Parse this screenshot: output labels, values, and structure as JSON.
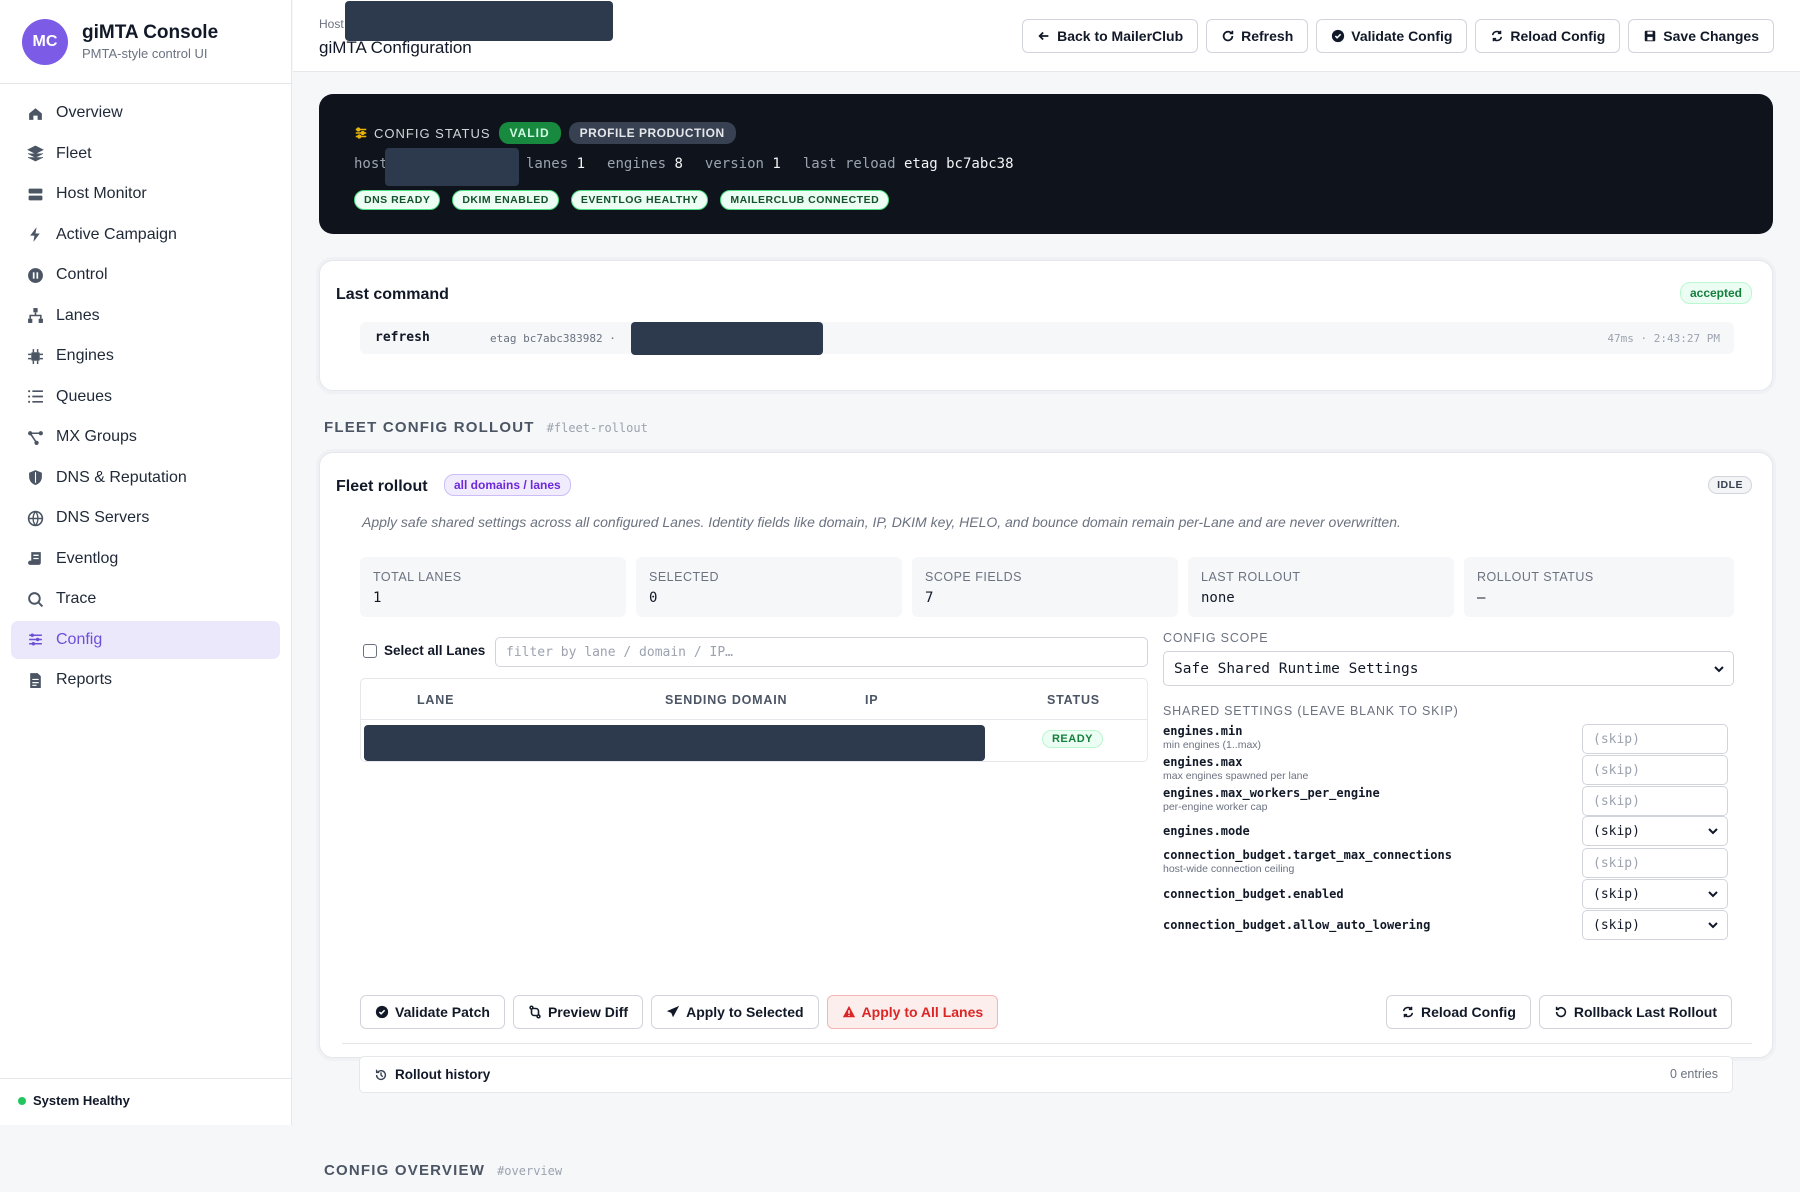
{
  "brand": {
    "initials": "MC",
    "title": "giMTA Console",
    "subtitle": "PMTA-style control UI"
  },
  "nav": [
    {
      "label": "Overview",
      "icon": "home-icon"
    },
    {
      "label": "Fleet",
      "icon": "layers-icon"
    },
    {
      "label": "Host Monitor",
      "icon": "server-icon"
    },
    {
      "label": "Active Campaign",
      "icon": "bolt-icon"
    },
    {
      "label": "Control",
      "icon": "pause-icon"
    },
    {
      "label": "Lanes",
      "icon": "network-icon"
    },
    {
      "label": "Engines",
      "icon": "chip-icon"
    },
    {
      "label": "Queues",
      "icon": "list-icon"
    },
    {
      "label": "MX Groups",
      "icon": "share-icon"
    },
    {
      "label": "DNS & Reputation",
      "icon": "shield-icon"
    },
    {
      "label": "DNS Servers",
      "icon": "globe-icon"
    },
    {
      "label": "Eventlog",
      "icon": "scroll-icon"
    },
    {
      "label": "Trace",
      "icon": "search-icon"
    },
    {
      "label": "Config",
      "icon": "sliders-icon",
      "active": true
    },
    {
      "label": "Reports",
      "icon": "file-icon"
    }
  ],
  "system_status": "System Healthy",
  "header": {
    "crumb": "Host",
    "title": "giMTA Configuration",
    "actions": [
      "Back to MailerClub",
      "Refresh",
      "Validate Config",
      "Reload Config",
      "Save Changes"
    ]
  },
  "config_status": {
    "label": "CONFIG STATUS",
    "valid": "VALID",
    "profile": "PROFILE PRODUCTION",
    "host_key": "host",
    "lanes_key": "lanes",
    "lanes_val": "1",
    "engines_key": "engines",
    "engines_val": "8",
    "version_key": "version",
    "version_val": "1",
    "reload_key": "last reload",
    "reload_val": "etag bc7abc38",
    "tags": [
      "DNS READY",
      "DKIM ENABLED",
      "EVENTLOG HEALTHY",
      "MAILERCLUB CONNECTED"
    ]
  },
  "last_command": {
    "title": "Last command",
    "badge": "accepted",
    "name": "refresh",
    "etag": "etag bc7abc383982 ·",
    "timing": "47ms · 2:43:27 PM"
  },
  "rollout_section": {
    "title": "FLEET CONFIG ROLLOUT",
    "anchor": "#fleet-rollout"
  },
  "rollout": {
    "title": "Fleet rollout",
    "scope_badge": "all domains / lanes",
    "state": "IDLE",
    "description": "Apply safe shared settings across all configured Lanes. Identity fields like domain, IP, DKIM key, HELO, and bounce domain remain per-Lane and are never overwritten.",
    "stats": [
      {
        "label": "TOTAL LANES",
        "value": "1"
      },
      {
        "label": "SELECTED",
        "value": "0"
      },
      {
        "label": "SCOPE FIELDS",
        "value": "7"
      },
      {
        "label": "LAST ROLLOUT",
        "value": "none"
      },
      {
        "label": "ROLLOUT STATUS",
        "value": "–"
      }
    ],
    "select_all": "Select all Lanes",
    "filter_placeholder": "filter by lane / domain / IP…",
    "columns": [
      "LANE",
      "SENDING DOMAIN",
      "IP",
      "STATUS"
    ],
    "row_status": "READY",
    "scope_label": "CONFIG SCOPE",
    "scope_value": "Safe Shared Runtime Settings",
    "shared_label": "SHARED SETTINGS (LEAVE BLANK TO SKIP)",
    "settings": [
      {
        "key": "engines.min",
        "desc": "min engines (1..max)",
        "control": "input",
        "value": "(skip)"
      },
      {
        "key": "engines.max",
        "desc": "max engines spawned per lane",
        "control": "input",
        "value": "(skip)"
      },
      {
        "key": "engines.max_workers_per_engine",
        "desc": "per-engine worker cap",
        "control": "input",
        "value": "(skip)"
      },
      {
        "key": "engines.mode",
        "desc": "",
        "control": "select",
        "value": "(skip)"
      },
      {
        "key": "connection_budget.target_max_connections",
        "desc": "host-wide connection ceiling",
        "control": "input",
        "value": "(skip)"
      },
      {
        "key": "connection_budget.enabled",
        "desc": "",
        "control": "select",
        "value": "(skip)"
      },
      {
        "key": "connection_budget.allow_auto_lowering",
        "desc": "",
        "control": "select",
        "value": "(skip)"
      }
    ],
    "actions_left": [
      "Validate Patch",
      "Preview Diff",
      "Apply to Selected",
      "Apply to All Lanes"
    ],
    "actions_right": [
      "Reload Config",
      "Rollback Last Rollout"
    ],
    "history_label": "Rollout history",
    "history_count": "0 entries"
  },
  "overview_section": {
    "title": "CONFIG OVERVIEW",
    "anchor": "#overview"
  }
}
